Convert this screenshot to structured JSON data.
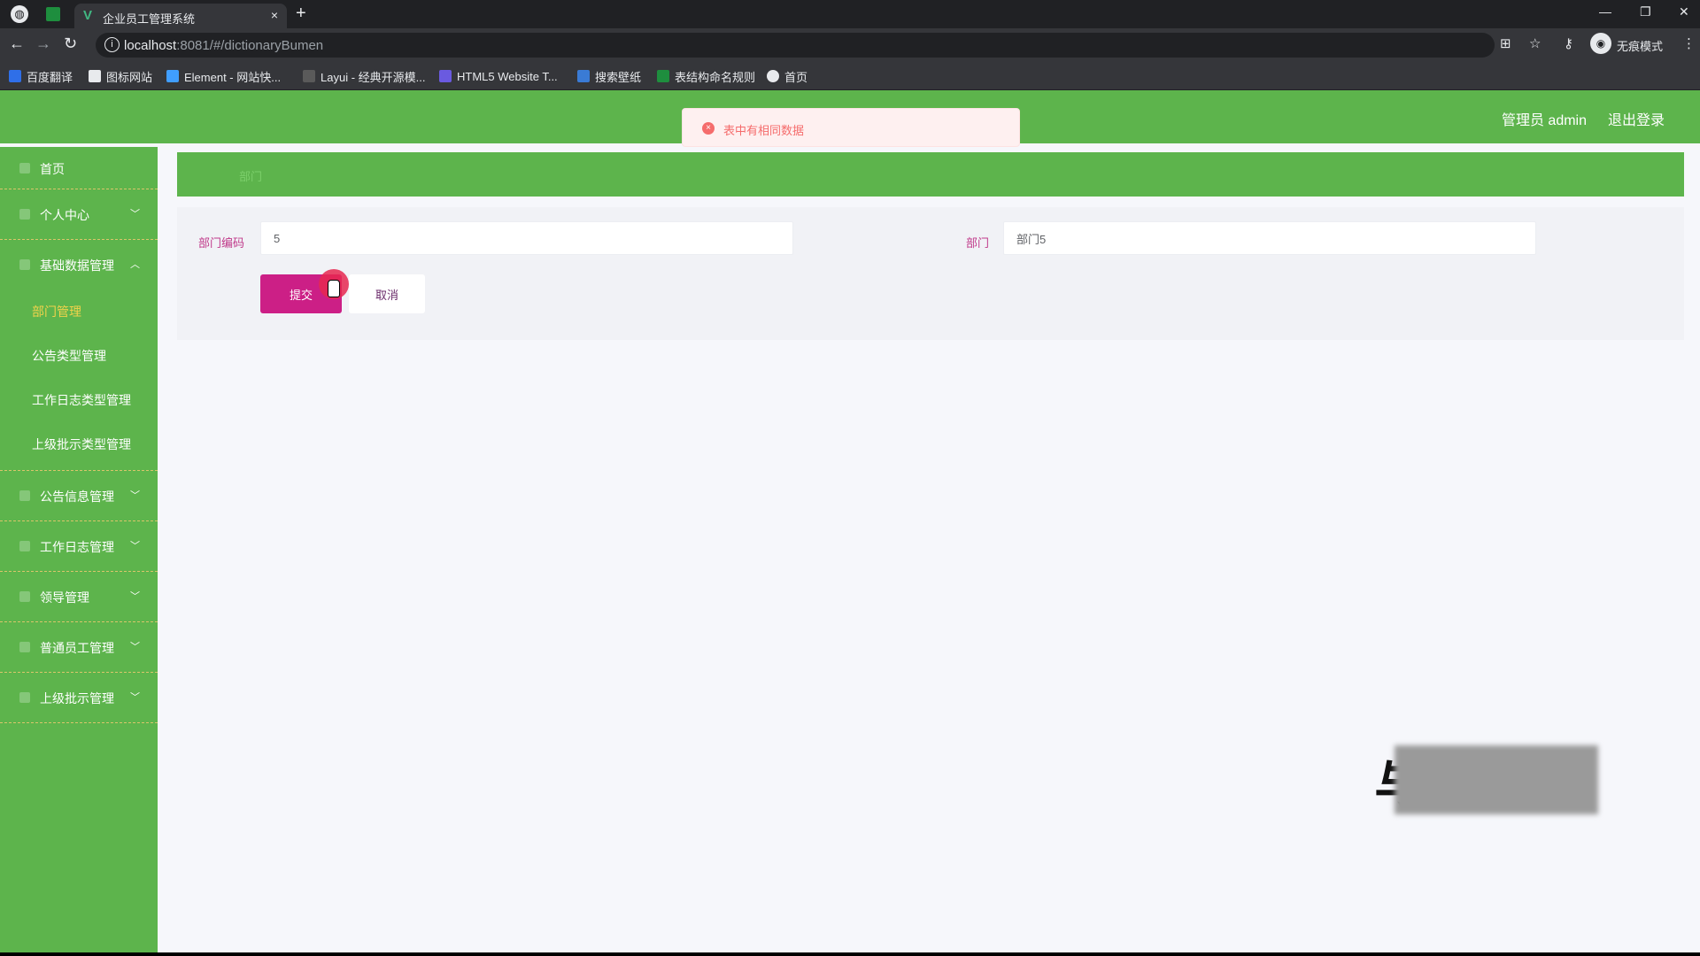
{
  "browser": {
    "tab_title": "企业员工管理系统",
    "tab_close": "×",
    "new_tab": "+",
    "url_host": "localhost",
    "url_path": ":8081/#/dictionaryBumen",
    "incognito_label": "无痕模式",
    "bookmarks": [
      {
        "label": "百度翻译",
        "color": "#2f6fe8"
      },
      {
        "label": "图标网站",
        "color": "#444444"
      },
      {
        "label": "Element - 网站快...",
        "color": "#409eff"
      },
      {
        "label": "Layui - 经典开源模...",
        "color": "#5a5a5a"
      },
      {
        "label": "HTML5 Website T...",
        "color": "#6a5ae0"
      },
      {
        "label": "搜索壁纸",
        "color": "#3a7bd5"
      },
      {
        "label": "表结构命名规则",
        "color": "#1e8e3e"
      },
      {
        "label": "首页",
        "color": "#e8eaed"
      }
    ]
  },
  "header": {
    "user": "管理员 admin",
    "logout": "退出登录"
  },
  "toast": {
    "message": "表中有相同数据",
    "color": "#f56c6c"
  },
  "sidebar": {
    "items": [
      {
        "label": "首页",
        "arrow": ""
      },
      {
        "label": "个人中心",
        "arrow": "﹀"
      },
      {
        "label": "基础数据管理",
        "arrow": "︿"
      },
      {
        "label": "公告信息管理",
        "arrow": "﹀"
      },
      {
        "label": "工作日志管理",
        "arrow": "﹀"
      },
      {
        "label": "领导管理",
        "arrow": "﹀"
      },
      {
        "label": "普通员工管理",
        "arrow": "﹀"
      },
      {
        "label": "上级批示管理",
        "arrow": "﹀"
      }
    ],
    "sub_items": [
      "部门管理",
      "公告类型管理",
      "工作日志类型管理",
      "上级批示类型管理"
    ],
    "active_sub": "部门管理"
  },
  "breadcrumb": {
    "text": "部门"
  },
  "form": {
    "code_label": "部门编码",
    "code_value": "5",
    "name_label": "部门",
    "name_value": "部门5",
    "submit": "提交",
    "cancel": "取消"
  },
  "colors": {
    "primary": "#5db44c",
    "submit": "#cc1f86",
    "active_menu": "#f0d24b"
  }
}
